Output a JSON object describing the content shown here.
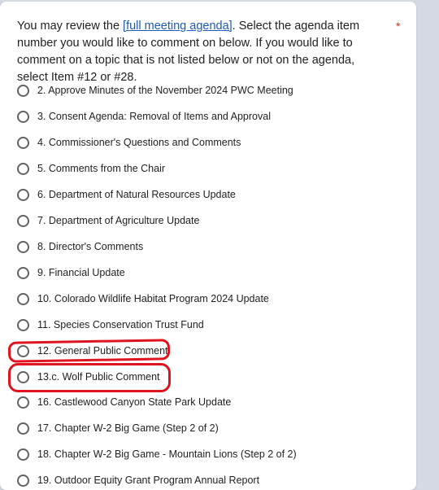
{
  "question": {
    "text_before": "You may review the ",
    "link_text": "[full meeting agenda]",
    "text_after": ". Select the agenda item number you would like to comment on below. If you would like to comment on a topic that is not listed below or not on the agenda, select Item #12 or #28.",
    "required_mark": "*"
  },
  "options": [
    "2. Approve Minutes of the November 2024 PWC Meeting",
    "3. Consent Agenda: Removal of Items and Approval",
    "4. Commissioner's Questions and Comments",
    "5. Comments from the Chair",
    "6. Department of Natural Resources Update",
    "7. Department of Agriculture Update",
    "8. Director's Comments",
    "9. Financial Update",
    "10. Colorado Wildlife Habitat Program 2024 Update",
    "11. Species Conservation Trust Fund",
    "12. General Public Comment",
    "13.c. Wolf Public Comment",
    "16. Castlewood Canyon State Park Update",
    "17. Chapter W-2 Big Game (Step 2 of 2)",
    "18. Chapter W-2 Big Game - Mountain Lions (Step 2 of 2)",
    "19. Outdoor Equity Grant Program Annual Report"
  ],
  "colors": {
    "background": "#d6dbe2",
    "card": "#ffffff",
    "link": "#1a5bb8",
    "required": "#d93025",
    "annotation": "#e0141e"
  }
}
